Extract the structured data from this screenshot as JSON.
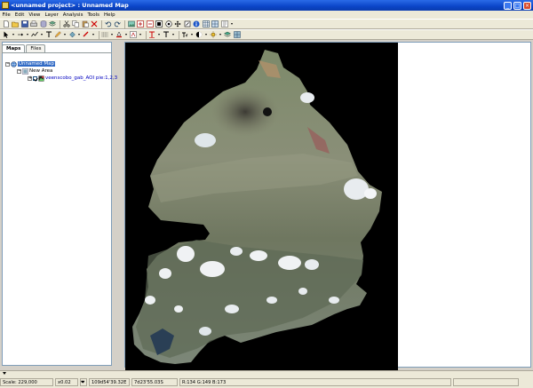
{
  "window": {
    "title": "<unnamed project> : Unnamed Map",
    "min_label": "_",
    "max_label": "□",
    "close_label": "×"
  },
  "menu": [
    "File",
    "Edit",
    "View",
    "Layer",
    "Analysis",
    "Tools",
    "Help"
  ],
  "toolbar1": [
    "new-icon",
    "open-icon",
    "save-icon",
    "print-icon",
    "database-icon",
    "layers-icon",
    "cut-icon",
    "copy-icon",
    "paste-icon",
    "delete-icon",
    "undo-icon",
    "redo-icon",
    "add-image-icon",
    "zoom-in-icon",
    "zoom-out-icon",
    "zoom-layer-icon",
    "zoom-full-icon",
    "pan-icon",
    "measure-icon",
    "info-icon",
    "table-icon",
    "grid-icon",
    "query-icon"
  ],
  "toolbar2": [
    "select-arrow-icon",
    "point-icon",
    "line-icon",
    "polyline-icon",
    "text-icon",
    "pencil-icon",
    "fill-icon",
    "color-icon",
    "line-style-icon",
    "fill-style-icon",
    "text-color-icon",
    "font-icon",
    "font-size-icon",
    "symbol-icon",
    "label-icon",
    "style-icon",
    "highlight-icon",
    "options-icon"
  ],
  "tabs": [
    {
      "label": "Maps",
      "active": true
    },
    {
      "label": "Files",
      "active": false
    }
  ],
  "tree": {
    "map": "Unnamed Map",
    "area": "New Area",
    "layer": "veenscobo_gab_AOI pie:1,2,3"
  },
  "status": {
    "scale": "Scale: 229,000",
    "zoom": "x0.02",
    "coords": "109d54'39.32E",
    "coords2": "7d23'55.03S",
    "rgb": "R:134 G:149 B:173"
  },
  "colors": {
    "titlebar": "#0b45c8",
    "selection": "#316ac5",
    "map_background": "#000000"
  }
}
